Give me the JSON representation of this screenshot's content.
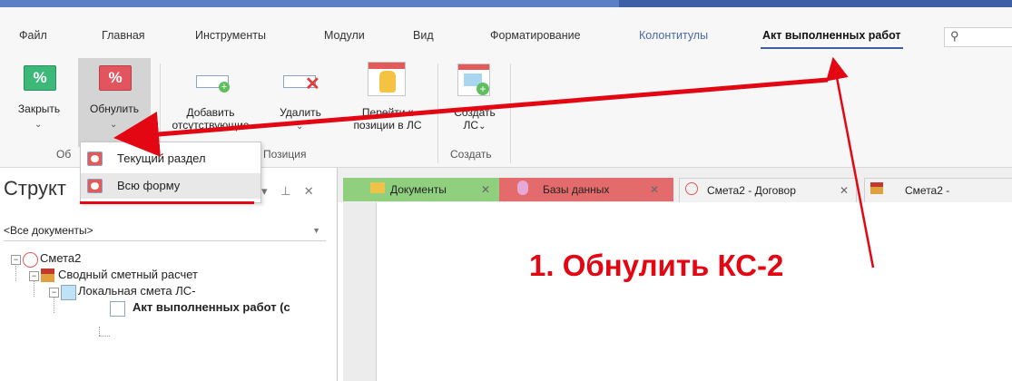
{
  "menu": {
    "tabs": [
      "Файл",
      "Главная",
      "Инструменты",
      "Модули",
      "Вид",
      "Форматирование",
      "Колонтитулы",
      "Акт выполненных работ"
    ],
    "active_tab": "Акт выполненных работ",
    "search_icon": "lightbulb-icon"
  },
  "ribbon": {
    "close_label": "Закрыть",
    "reset_label": "Обнулить",
    "add_missing_label_1": "Добавить",
    "add_missing_label_2": "отсутствующие",
    "delete_label": "Удалить",
    "goto_label_1": "Перейти к",
    "goto_label_2": "позиции в ЛС",
    "create_label_1": "Создать",
    "create_label_2": "ЛС",
    "percent_glyph": "%",
    "group_reset": "Об",
    "group_position": "Позиция",
    "group_create": "Создать",
    "colors": {
      "close_icon": "#3cb878",
      "reset_icon": "#e2555f"
    }
  },
  "dropdown": {
    "items": [
      "Текущий раздел",
      "Всю форму"
    ]
  },
  "left_panel": {
    "title": "Структ",
    "filter_value": "<Все документы>",
    "tree": [
      "Смета2",
      "Сводный сметный расчет",
      "Локальная смета ЛС-",
      "Акт выполненных работ (с"
    ]
  },
  "doc_tabs": [
    {
      "label": "Документы",
      "color": "#8fcf7e"
    },
    {
      "label": "Базы данных",
      "color": "#e46b6b"
    },
    {
      "label": "Смета2 - Договор",
      "color": "#f2f2f2"
    },
    {
      "label": "Смета2 -",
      "color": "#f2f2f2"
    }
  ],
  "annotation": {
    "text": "1. Обнулить КС-2",
    "color": "#e30613"
  }
}
